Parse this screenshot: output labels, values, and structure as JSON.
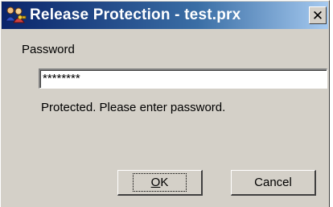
{
  "window": {
    "title": "Release Protection - test.prx",
    "close_glyph": "✕",
    "app_icon": "key-people-icon"
  },
  "form": {
    "password_label": "Password",
    "password_value": "********",
    "message": "Protected. Please enter password."
  },
  "buttons": {
    "ok_mnemonic": "O",
    "ok_rest": "K",
    "cancel_label": "Cancel"
  },
  "colors": {
    "title_start": "#0a246a",
    "title_end": "#a6caf0",
    "face": "#d4d0c8"
  }
}
